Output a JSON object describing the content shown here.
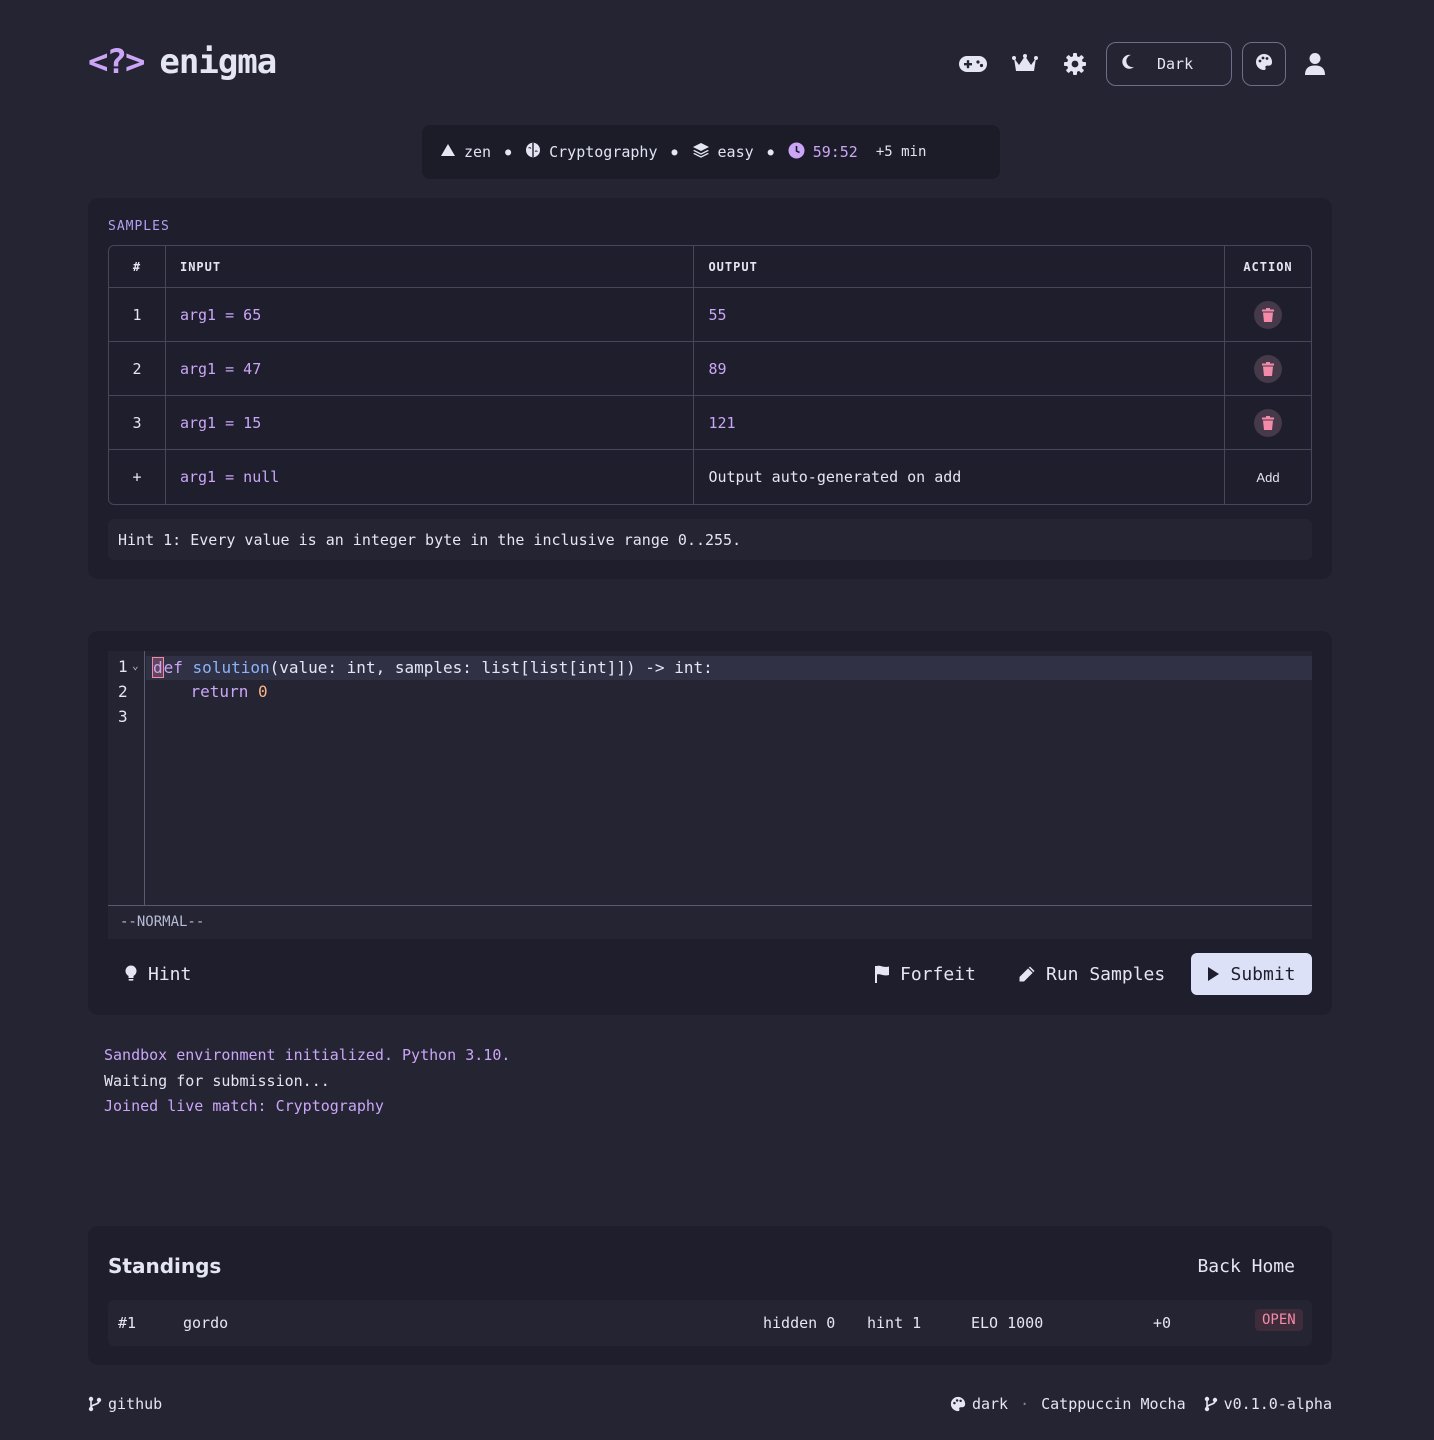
{
  "brand": {
    "mark": "<?>",
    "name": "enigma"
  },
  "header": {
    "icons": [
      "gamepad-icon",
      "crown-icon",
      "gear-icon",
      "palette-icon",
      "user-icon"
    ],
    "theme_label": "Dark"
  },
  "meta": {
    "mode": "zen",
    "category": "Cryptography",
    "difficulty": "easy",
    "timer": "59:52",
    "extra_time": "+5 min"
  },
  "samples": {
    "section_label": "SAMPLES",
    "columns": [
      "#",
      "INPUT",
      "OUTPUT",
      "ACTION"
    ],
    "rows": [
      {
        "num": "1",
        "input": "arg1 = 65",
        "output": "55"
      },
      {
        "num": "2",
        "input": "arg1 = 47",
        "output": "89"
      },
      {
        "num": "3",
        "input": "arg1 = 15",
        "output": "121"
      }
    ],
    "new_row": {
      "num": "+",
      "input": "arg1 = null",
      "output": "Output auto-generated on add",
      "action": "Add"
    },
    "hint": "Hint 1: Every value is an integer byte in the inclusive range 0..255."
  },
  "editor": {
    "line_numbers": [
      "1",
      "2",
      "3"
    ],
    "code": {
      "l1_cursor": "d",
      "l1_kw_rest": "ef",
      "l1_fn": "solution",
      "l1_rest": "(value: int, samples: list[list[int]]) -> int:",
      "l2_indent": "    ",
      "l2_kw": "return",
      "l2_num": "0"
    },
    "mode": "--NORMAL--"
  },
  "actions": {
    "hint": "Hint",
    "forfeit": "Forfeit",
    "run": "Run Samples",
    "submit": "Submit"
  },
  "console": [
    "Sandbox environment initialized. Python 3.10.",
    "Waiting for submission...",
    "Joined live match: Cryptography"
  ],
  "standings": {
    "title": "Standings",
    "back": "Back Home",
    "rows": [
      {
        "rank": "#1",
        "name": "gordo",
        "hidden": "hidden 0",
        "hint": "hint 1",
        "elo": "ELO 1000",
        "delta": "+0",
        "status": "OPEN"
      }
    ]
  },
  "footer": {
    "github": "github",
    "theme": "dark",
    "palette": "Catppuccin Mocha",
    "version": "v0.1.0-alpha"
  },
  "colors": {
    "background": "#242433",
    "panel": "#1e1e2d",
    "accent": "#cba6f7",
    "danger": "#f38ba8",
    "text": "#cdd6f4"
  }
}
